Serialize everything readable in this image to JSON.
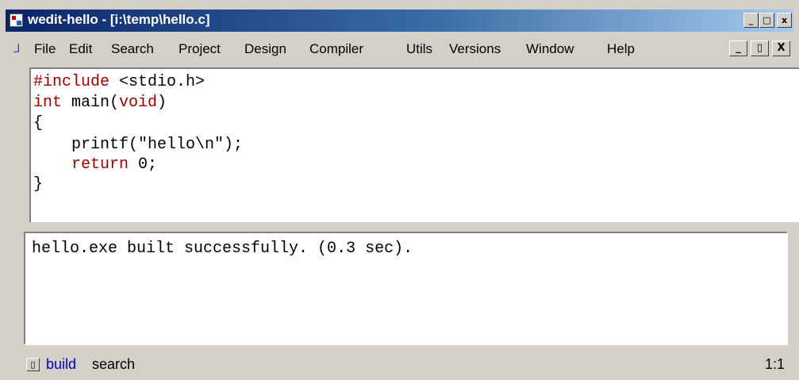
{
  "window": {
    "title": "wedit-hello - [i:\\temp\\hello.c]",
    "caption_buttons": [
      "_",
      "□",
      "x"
    ]
  },
  "menubar": {
    "items": [
      "File",
      "Edit",
      "Search",
      "Project",
      "Design",
      "Compiler",
      "Utils",
      "Versions",
      "Window",
      "Help"
    ],
    "mdi_buttons": [
      "_",
      "▯",
      "X"
    ]
  },
  "editor": {
    "file": "hello.c",
    "lines": [
      {
        "pre": "",
        "kw": "#include",
        "post": " <stdio.h>"
      },
      {
        "pre": "",
        "kw": "int",
        "post": " main("
      },
      {
        "pre": "{",
        "kw": "",
        "post": ""
      },
      {
        "pre": "    printf(\"hello\\n\");",
        "kw": "",
        "post": ""
      },
      {
        "pre": "    ",
        "kw": "return",
        "post": " 0;"
      },
      {
        "pre": "}",
        "kw": "",
        "post": ""
      }
    ],
    "line2_kw2": "void",
    "line2_tail": ")"
  },
  "output": {
    "text": "hello.exe built successfully. (0.3 sec)."
  },
  "statusbar": {
    "tabs": [
      "build",
      "search"
    ],
    "position": "1:1"
  },
  "colors": {
    "keyword": "#a00000",
    "title_bar_start": "#0a246a",
    "title_bar_end": "#a6caf0",
    "active_tab": "#0000cc"
  }
}
